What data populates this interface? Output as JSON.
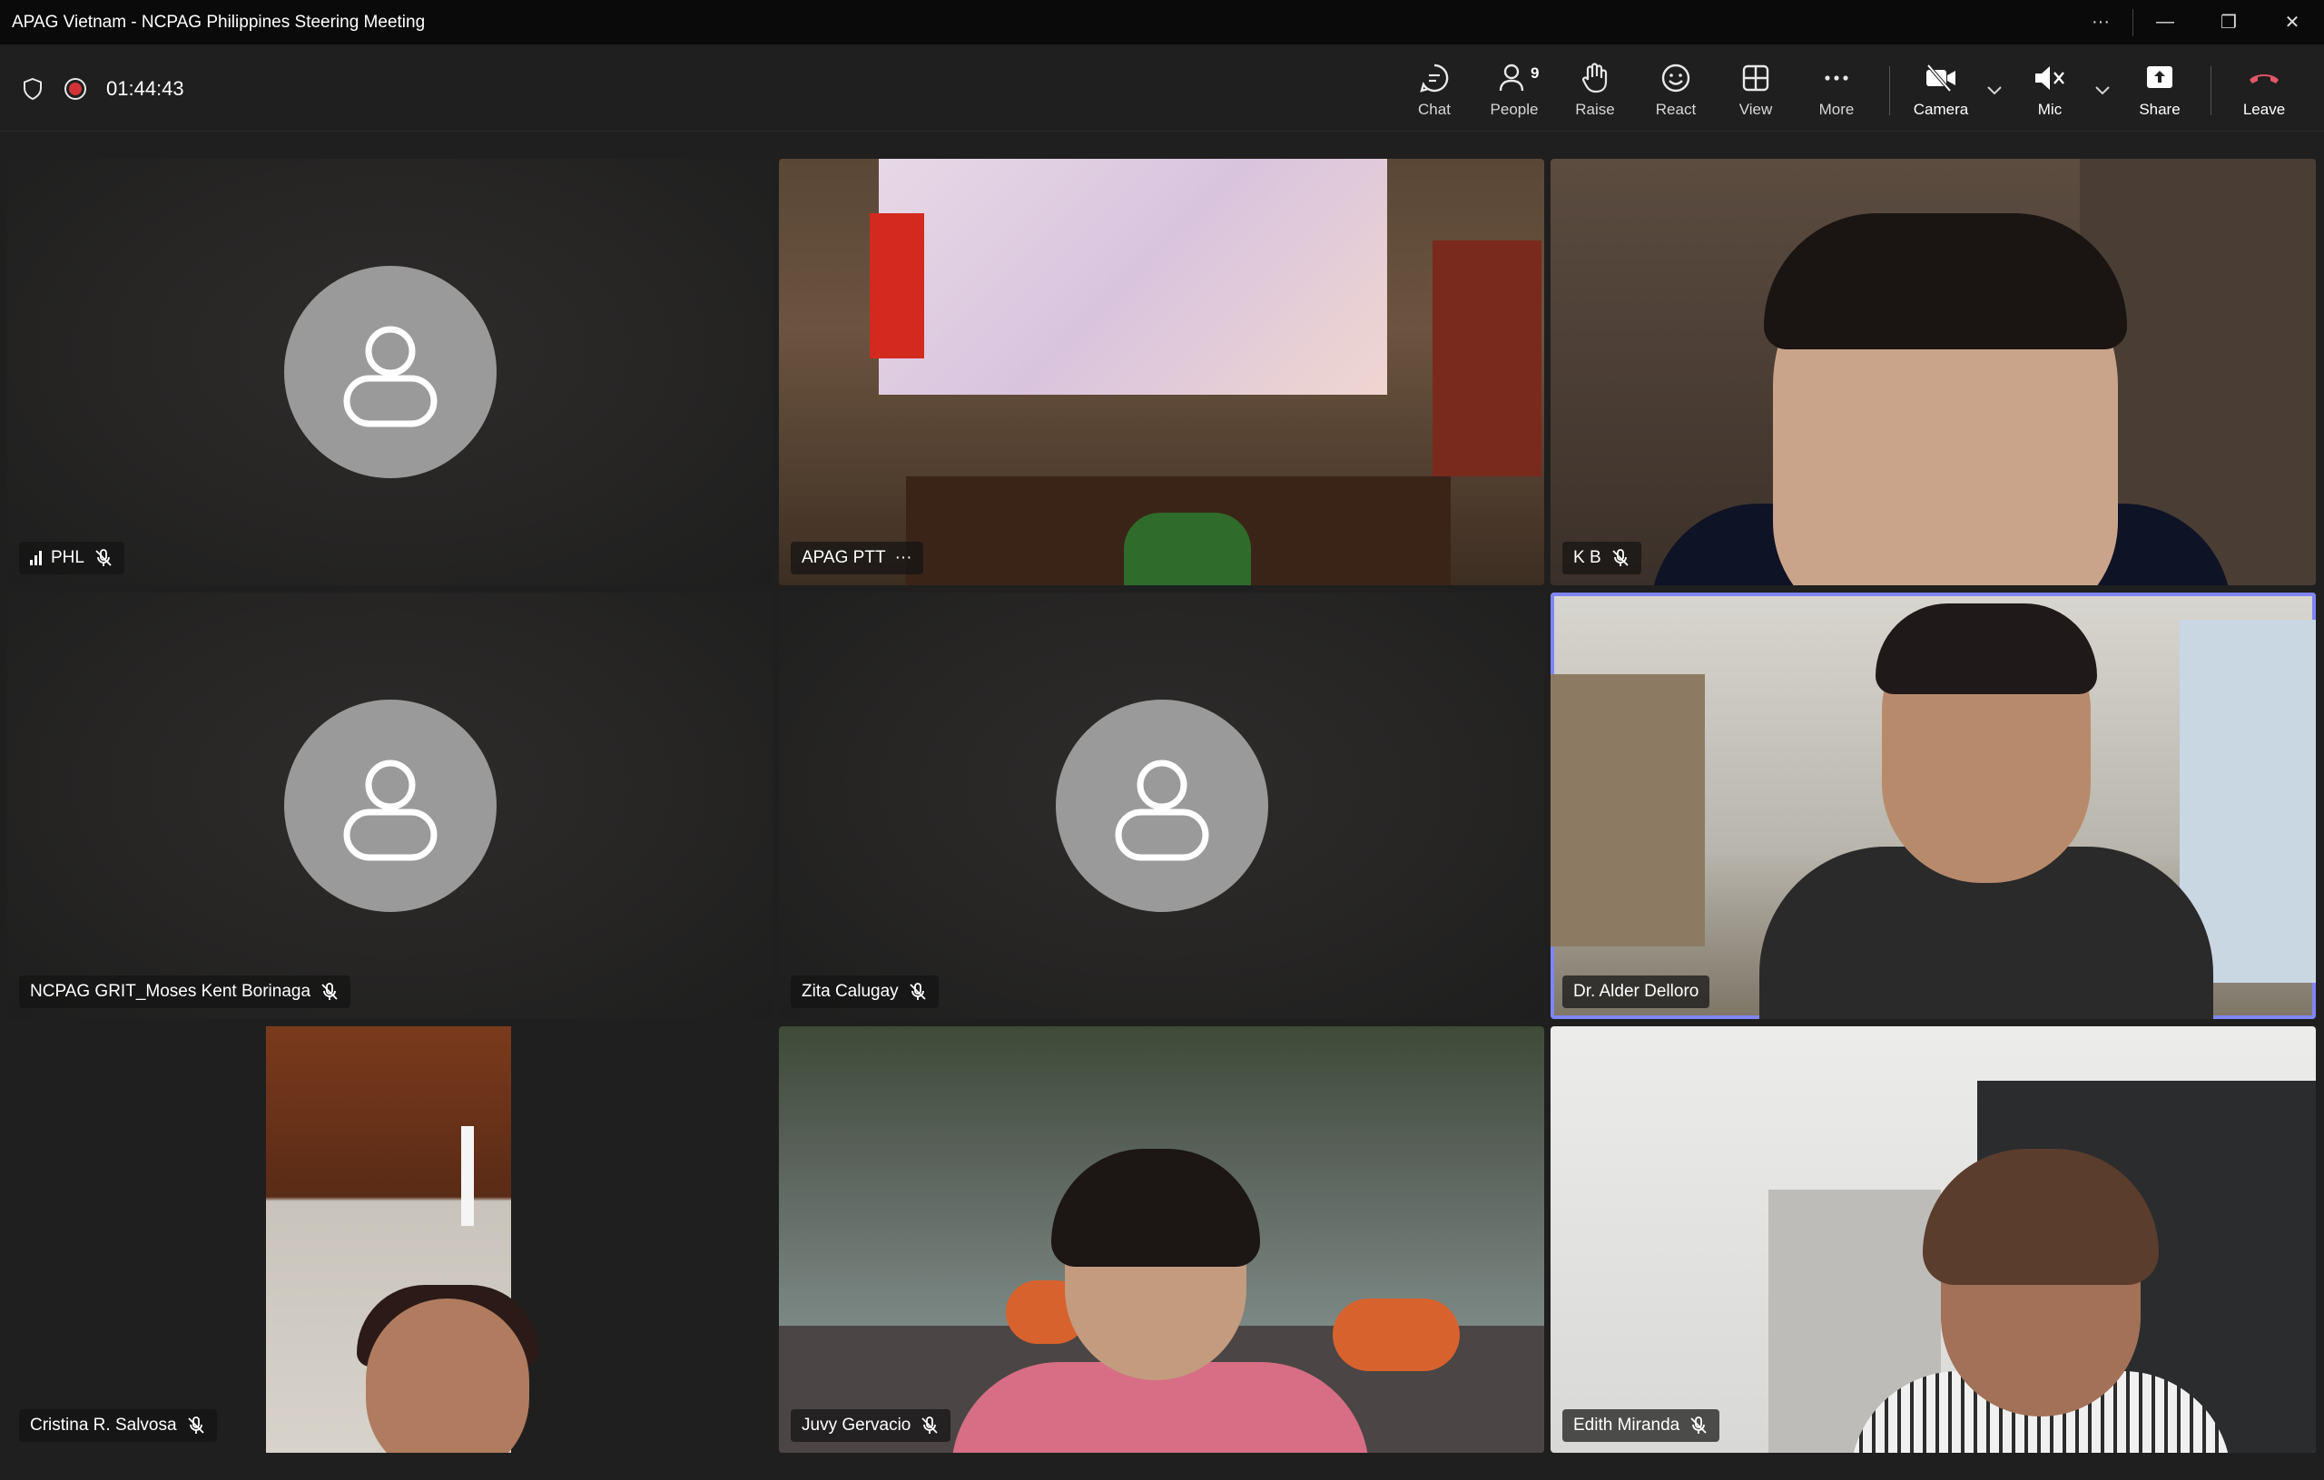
{
  "window": {
    "title": "APAG Vietnam - NCPAG Philippines Steering Meeting",
    "controls": {
      "more": "···",
      "minimize": "—",
      "restore": "❐",
      "close": "✕"
    }
  },
  "toolbar": {
    "timer": "01:44:43",
    "people_count": "9",
    "buttons": {
      "chat": "Chat",
      "people": "People",
      "raise": "Raise",
      "react": "React",
      "view": "View",
      "more": "More",
      "camera": "Camera",
      "mic": "Mic",
      "share": "Share",
      "leave": "Leave"
    },
    "colors": {
      "leave": "#e3566b",
      "record": "#d13438",
      "speaking": "#7f85f5"
    }
  },
  "tiles": [
    {
      "name": "PHL",
      "video": false,
      "muted": true,
      "signal": true
    },
    {
      "name": "APAG PTT",
      "video": true,
      "muted": false,
      "more": "···"
    },
    {
      "name": "K B",
      "video": true,
      "muted": true
    },
    {
      "name": "NCPAG GRIT_Moses Kent Borinaga",
      "video": false,
      "muted": true
    },
    {
      "name": "Zita Calugay",
      "video": false,
      "muted": true
    },
    {
      "name": "Dr. Alder Delloro",
      "video": true,
      "muted": false,
      "speaking": true
    },
    {
      "name": "Cristina R. Salvosa",
      "video": true,
      "muted": true
    },
    {
      "name": "Juvy Gervacio",
      "video": true,
      "muted": true
    },
    {
      "name": "Edith Miranda",
      "video": true,
      "muted": true
    }
  ]
}
